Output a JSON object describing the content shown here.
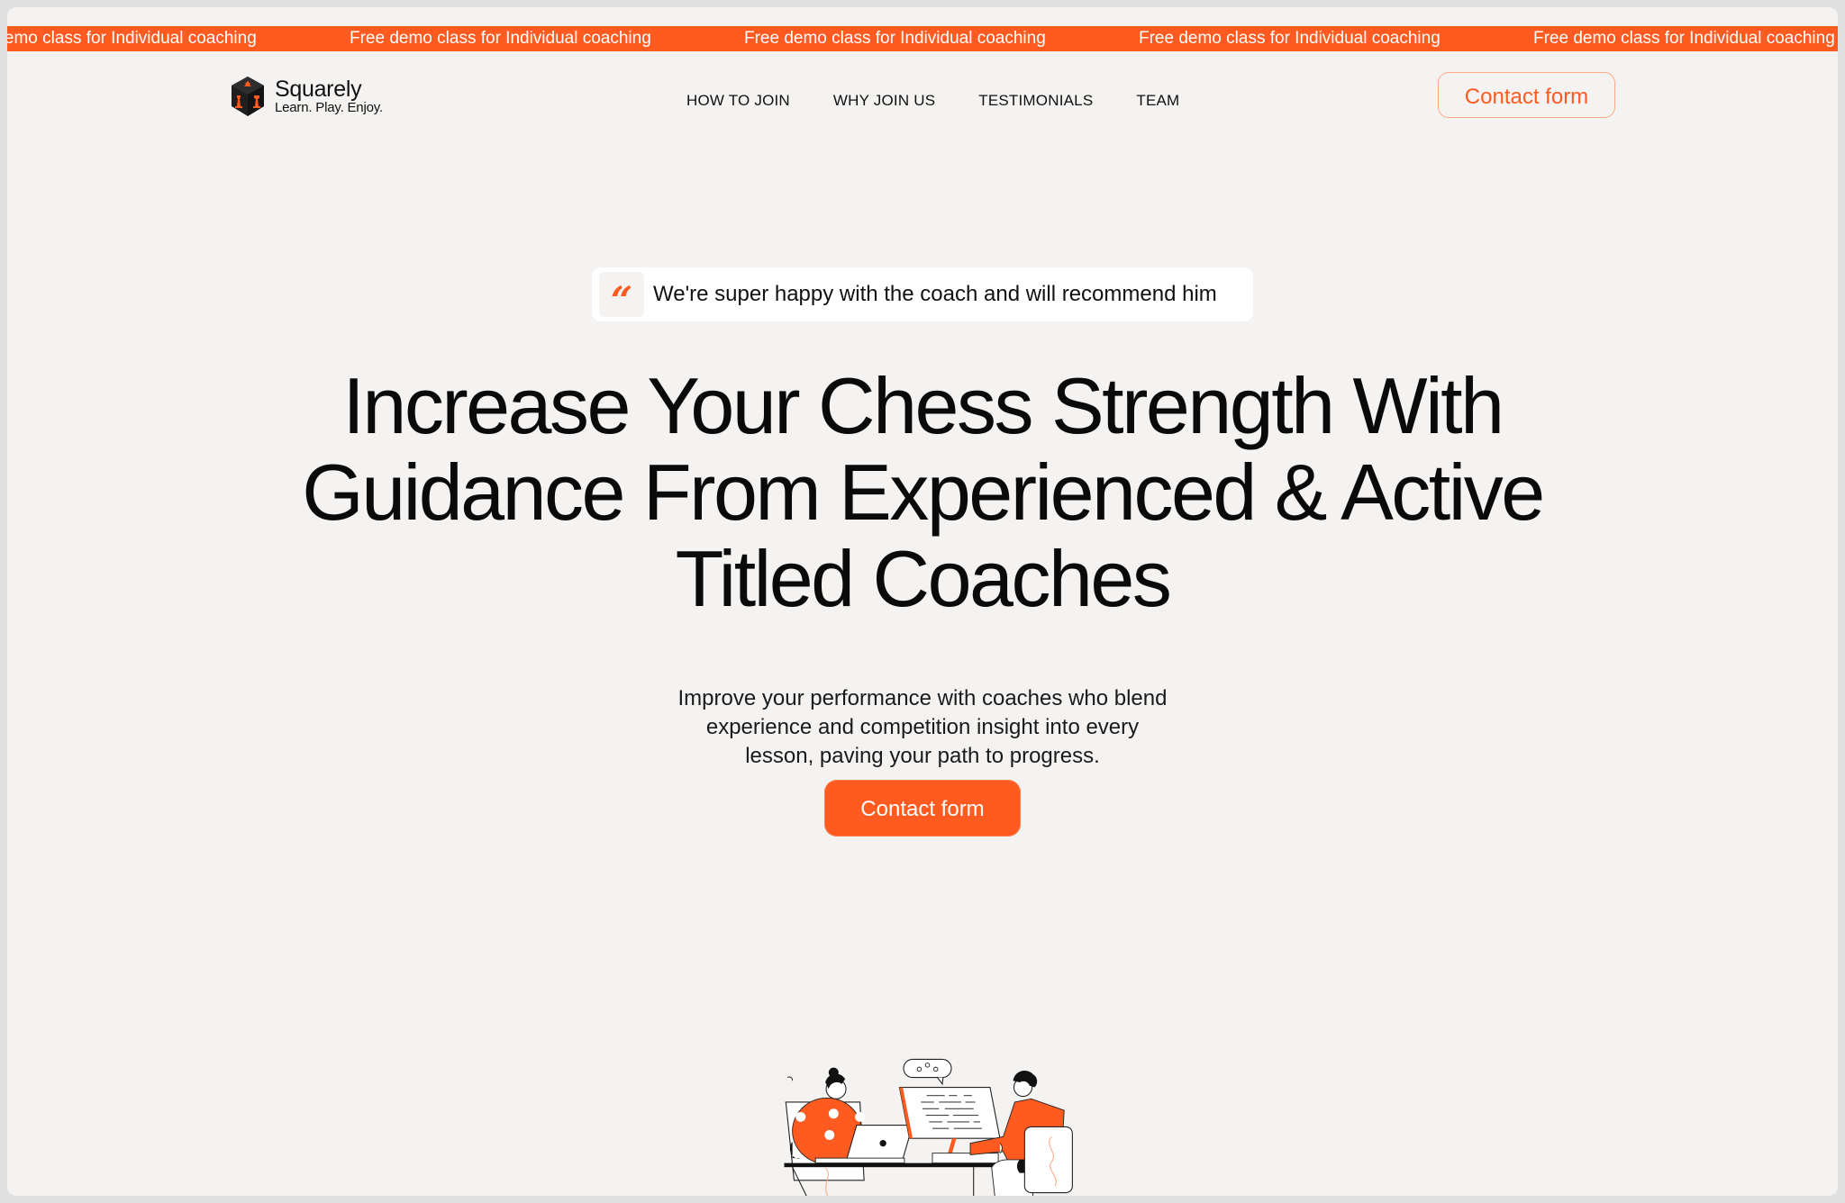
{
  "ticker": {
    "items": [
      "Free demo class for Individual coaching",
      "Free demo class for Individual coaching",
      "Free demo class for Individual coaching",
      "Free demo class for Individual coaching",
      "Free demo class for Individual coaching",
      "Free demo class for Individual coaching"
    ]
  },
  "brand": {
    "name": "Squarely",
    "tagline": "Learn. Play. Enjoy.",
    "logo_icon": "chess-cube-icon"
  },
  "nav": {
    "links": [
      "HOW TO JOIN",
      "WHY JOIN US",
      "TESTIMONIALS",
      "TEAM"
    ],
    "cta_label": "Contact form"
  },
  "hero": {
    "quote_icon": "quote-mark-icon",
    "quote": "We're super happy with the coach and will recommend him",
    "headline_lines": [
      "Increase Your Chess Strength With",
      "Guidance From Experienced & Active",
      "Titled Coaches"
    ],
    "subtitle_lines": [
      "Improve your performance with coaches who blend",
      "experience and competition insight into every",
      "lesson, paving your path to progress."
    ],
    "cta_label": "Contact form",
    "illustration": "coaching-session-illustration"
  },
  "colors": {
    "accent": "#ff5a1f",
    "background": "#f4f3f1",
    "frame": "#e0e0e0",
    "text": "#0a0a0a"
  }
}
